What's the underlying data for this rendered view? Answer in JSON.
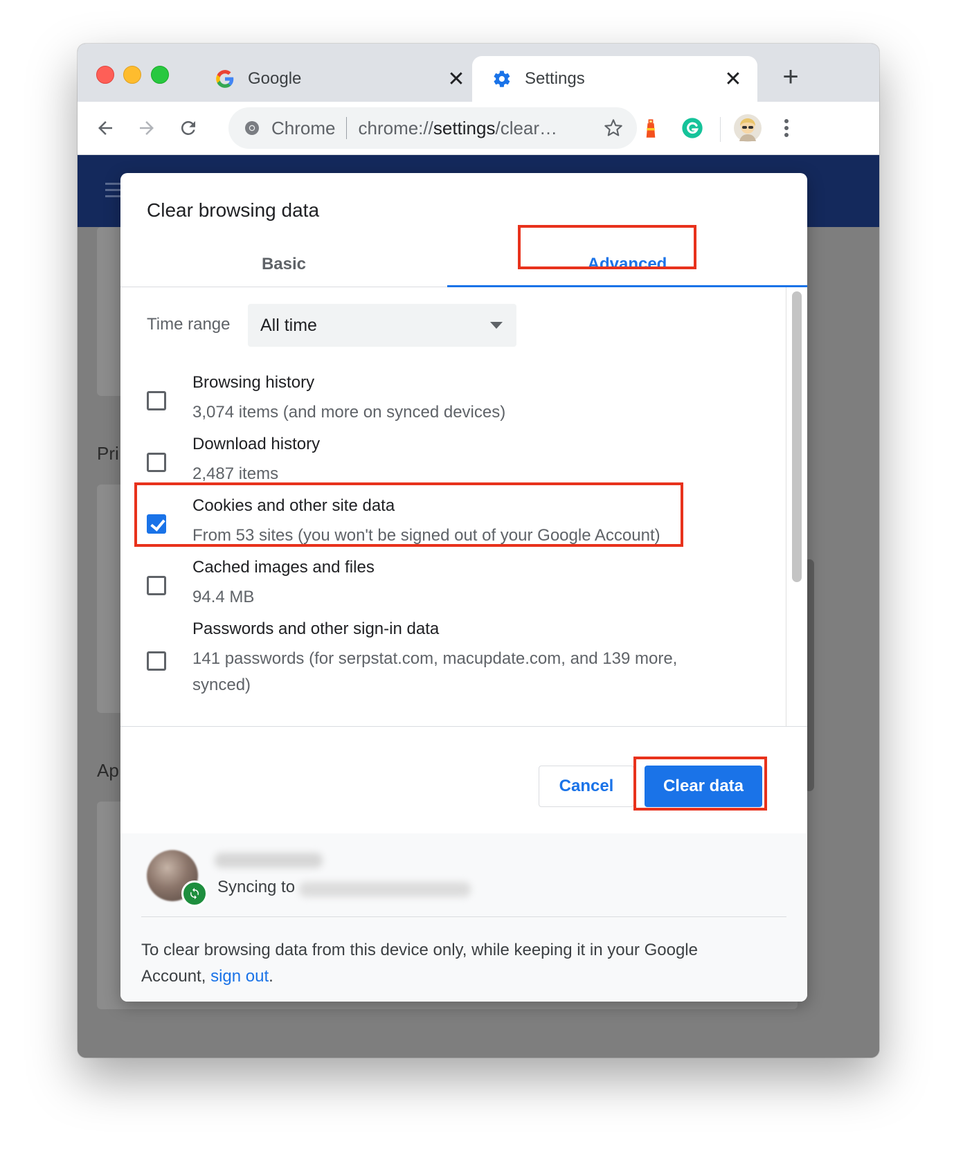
{
  "window": {
    "tabs": [
      {
        "title": "Google",
        "icon": "google-g-icon"
      },
      {
        "title": "Settings",
        "icon": "gear-icon"
      }
    ],
    "close_glyph": "✕",
    "new_tab_glyph": "+"
  },
  "omnibox": {
    "chip_label": "Chrome",
    "url_prefix": "chrome://",
    "url_host": "settings",
    "url_rest": "/clear…"
  },
  "background_page": {
    "section_1_stub": "Pri",
    "section_2_stub": "Ap"
  },
  "dialog": {
    "title": "Clear browsing data",
    "tabs": {
      "basic": "Basic",
      "advanced": "Advanced",
      "selected": "Advanced"
    },
    "time_range": {
      "label": "Time range",
      "value": "All time"
    },
    "items": [
      {
        "title": "Browsing history",
        "subtitle": "3,074 items (and more on synced devices)",
        "checked": false
      },
      {
        "title": "Download history",
        "subtitle": "2,487 items",
        "checked": false
      },
      {
        "title": "Cookies and other site data",
        "subtitle": "From 53 sites (you won't be signed out of your Google Account)",
        "checked": true
      },
      {
        "title": "Cached images and files",
        "subtitle": "94.4 MB",
        "checked": false
      },
      {
        "title": "Passwords and other sign-in data",
        "subtitle": "141 passwords (for serpstat.com, macupdate.com, and 139 more, synced)",
        "checked": false
      }
    ],
    "buttons": {
      "cancel": "Cancel",
      "clear": "Clear data"
    },
    "footer": {
      "syncing_label": "Syncing to",
      "note_prefix": "To clear browsing data from this device only, while keeping it in your Google Account,",
      "note_link": "sign out",
      "note_suffix": "."
    }
  },
  "colors": {
    "accent": "#1a73e8",
    "highlight_box": "#e8321c",
    "page_header": "#14295c"
  }
}
